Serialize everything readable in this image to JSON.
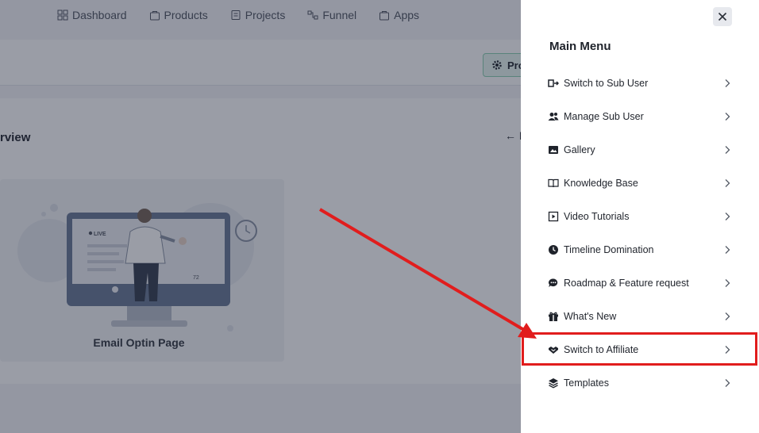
{
  "topnav": {
    "items": [
      {
        "label": "Dashboard",
        "icon": "dashboard-icon"
      },
      {
        "label": "Products",
        "icon": "products-icon"
      },
      {
        "label": "Projects",
        "icon": "projects-icon"
      },
      {
        "label": "Funnel",
        "icon": "funnel-icon"
      },
      {
        "label": "Apps",
        "icon": "apps-icon"
      }
    ]
  },
  "toolbar": {
    "button_label": "Pro"
  },
  "main": {
    "section_title": "rview",
    "back_label": "← B",
    "card": {
      "title": "Email Optin Page",
      "live_badge": "LIVE",
      "viewer_count": "72"
    }
  },
  "drawer": {
    "title": "Main Menu",
    "items": [
      {
        "label": "Switch to Sub User",
        "icon": "switch-user-icon"
      },
      {
        "label": "Manage Sub User",
        "icon": "users-icon"
      },
      {
        "label": "Gallery",
        "icon": "gallery-icon"
      },
      {
        "label": "Knowledge Base",
        "icon": "book-icon"
      },
      {
        "label": "Video Tutorials",
        "icon": "play-icon"
      },
      {
        "label": "Timeline Domination",
        "icon": "clock-icon"
      },
      {
        "label": "Roadmap & Feature request",
        "icon": "chat-icon"
      },
      {
        "label": "What's New",
        "icon": "gift-icon"
      },
      {
        "label": "Switch to Affiliate",
        "icon": "handshake-icon"
      },
      {
        "label": "Templates",
        "icon": "layers-icon"
      }
    ]
  },
  "colors": {
    "highlight": "#e11d1d",
    "overlay": "#0f162c"
  }
}
